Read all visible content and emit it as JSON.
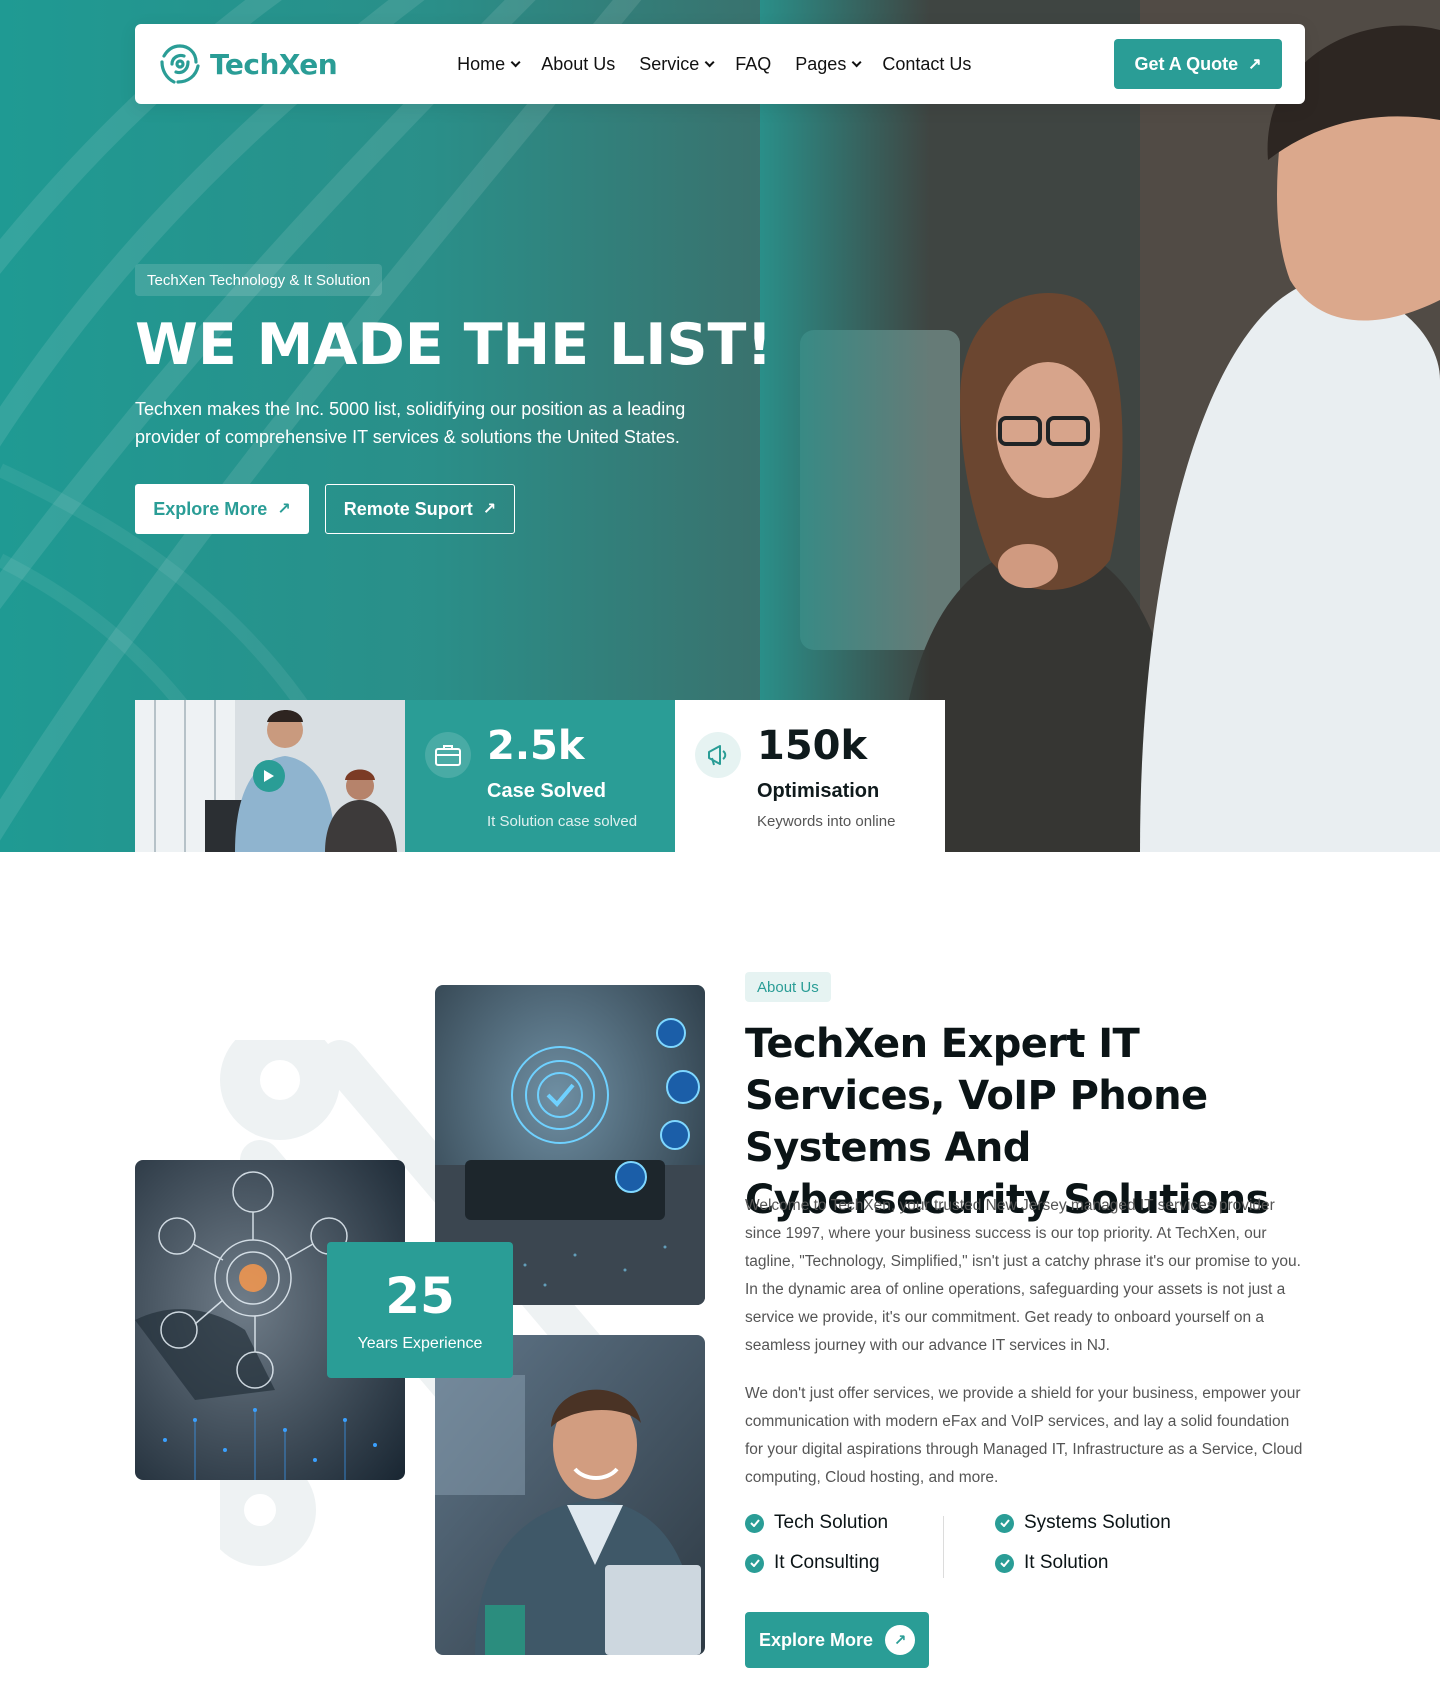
{
  "brand": {
    "name": "TechXen"
  },
  "nav": {
    "items": [
      {
        "label": "Home",
        "dropdown": true
      },
      {
        "label": "About Us",
        "dropdown": false
      },
      {
        "label": "Service",
        "dropdown": true
      },
      {
        "label": "FAQ",
        "dropdown": false
      },
      {
        "label": "Pages",
        "dropdown": true
      },
      {
        "label": "Contact Us",
        "dropdown": false
      }
    ],
    "cta": "Get A Quote"
  },
  "hero": {
    "tag": "TechXen Technology & It Solution",
    "title": "WE MADE THE LIST!",
    "text": "Techxen makes the Inc. 5000 list, solidifying our position as a leading provider of comprehensive IT services & solutions the United States.",
    "primary_button": "Explore More",
    "secondary_button": "Remote Suport"
  },
  "stats": [
    {
      "number": "2.5k",
      "label": "Case Solved",
      "sub": "It Solution case solved",
      "icon": "briefcase-icon"
    },
    {
      "number": "150k",
      "label": "Optimisation",
      "sub": "Keywords into online",
      "icon": "megaphone-icon"
    }
  ],
  "about": {
    "tag": "About Us",
    "title": "TechXen Expert IT Services, VoIP Phone Systems And Cybersecurity Solutions",
    "p1": "Welcome to TechXen, your trusted New Jersey managed IT services provider since 1997, where your business success is our top priority. At TechXen, our tagline, \"Technology, Simplified,\" isn't just a catchy phrase it's our promise to you. In the dynamic area of online operations, safeguarding your assets is not just a service we provide, it's our commitment. Get ready to onboard yourself on a seamless journey with our advance IT services in NJ.",
    "p2": "We don't just offer services, we provide a shield for your business, empower your communication with modern eFax and VoIP services, and lay a solid foundation for your digital aspirations through Managed IT, Infrastructure as a Service, Cloud computing, Cloud hosting, and more.",
    "experience": {
      "number": "25",
      "label": "Years Experience"
    },
    "features": [
      "Tech Solution",
      "It Consulting",
      "Systems Solution",
      "It Solution"
    ],
    "button": "Explore More"
  },
  "colors": {
    "accent": "#2a9d96",
    "dark": "#0b1416",
    "muted": "#555555"
  }
}
